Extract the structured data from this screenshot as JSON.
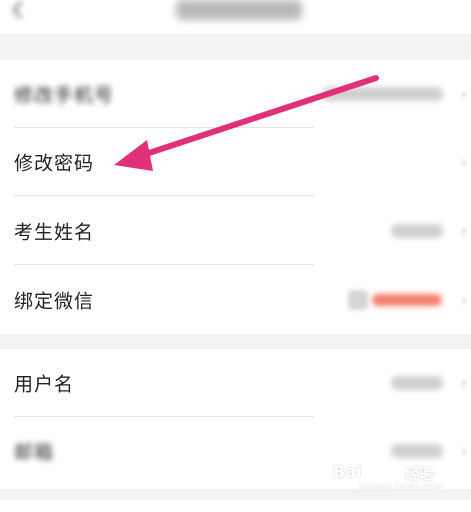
{
  "header": {
    "back_icon": "chevron-left-icon",
    "title_redacted": true
  },
  "settings_group_1": {
    "items": [
      {
        "label": "修改手机号",
        "value_redacted": true
      },
      {
        "label": "修改密码",
        "value_redacted": false
      },
      {
        "label": "考生姓名",
        "value_redacted": true
      },
      {
        "label": "绑定微信",
        "value_redacted": true
      }
    ]
  },
  "settings_group_2": {
    "items": [
      {
        "label": "用户名",
        "value_redacted": true
      },
      {
        "label": "邮箱",
        "value_redacted": true
      }
    ]
  },
  "annotation": {
    "arrow_color": "#e0307a",
    "target": "修改密码"
  },
  "watermark": {
    "brand": "Bai",
    "brand_cn": "经验",
    "url": "jingyan.baidu.com"
  },
  "colors": {
    "background": "#f3f3f3",
    "card": "#ffffff",
    "text": "#222222",
    "accent": "#e0307a",
    "wechat_status": "#f0725c"
  }
}
